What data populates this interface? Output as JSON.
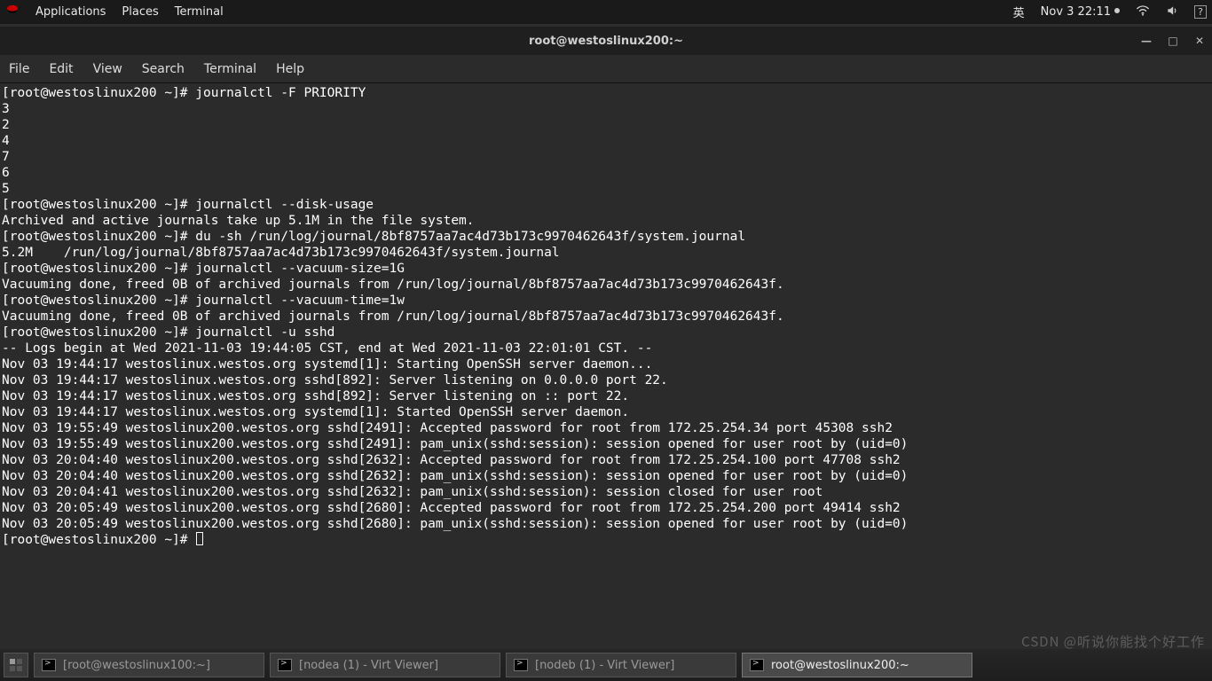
{
  "top_panel": {
    "applications": "Applications",
    "places": "Places",
    "terminal": "Terminal",
    "ime": "英",
    "datetime": "Nov 3  22:11"
  },
  "window": {
    "title": "root@westoslinux200:~"
  },
  "menubar": {
    "file": "File",
    "edit": "Edit",
    "view": "View",
    "search": "Search",
    "terminal": "Terminal",
    "help": "Help"
  },
  "terminal": {
    "lines": [
      "[root@westoslinux200 ~]# journalctl -F PRIORITY",
      "3",
      "2",
      "4",
      "7",
      "6",
      "5",
      "[root@westoslinux200 ~]# journalctl --disk-usage",
      "Archived and active journals take up 5.1M in the file system.",
      "[root@westoslinux200 ~]# du -sh /run/log/journal/8bf8757aa7ac4d73b173c9970462643f/system.journal",
      "5.2M    /run/log/journal/8bf8757aa7ac4d73b173c9970462643f/system.journal",
      "[root@westoslinux200 ~]# journalctl --vacuum-size=1G",
      "Vacuuming done, freed 0B of archived journals from /run/log/journal/8bf8757aa7ac4d73b173c9970462643f.",
      "[root@westoslinux200 ~]# journalctl --vacuum-time=1w",
      "Vacuuming done, freed 0B of archived journals from /run/log/journal/8bf8757aa7ac4d73b173c9970462643f.",
      "[root@westoslinux200 ~]# journalctl -u sshd",
      "-- Logs begin at Wed 2021-11-03 19:44:05 CST, end at Wed 2021-11-03 22:01:01 CST. --",
      "Nov 03 19:44:17 westoslinux.westos.org systemd[1]: Starting OpenSSH server daemon...",
      "Nov 03 19:44:17 westoslinux.westos.org sshd[892]: Server listening on 0.0.0.0 port 22.",
      "Nov 03 19:44:17 westoslinux.westos.org sshd[892]: Server listening on :: port 22.",
      "Nov 03 19:44:17 westoslinux.westos.org systemd[1]: Started OpenSSH server daemon.",
      "Nov 03 19:55:49 westoslinux200.westos.org sshd[2491]: Accepted password for root from 172.25.254.34 port 45308 ssh2",
      "Nov 03 19:55:49 westoslinux200.westos.org sshd[2491]: pam_unix(sshd:session): session opened for user root by (uid=0)",
      "Nov 03 20:04:40 westoslinux200.westos.org sshd[2632]: Accepted password for root from 172.25.254.100 port 47708 ssh2",
      "Nov 03 20:04:40 westoslinux200.westos.org sshd[2632]: pam_unix(sshd:session): session opened for user root by (uid=0)",
      "Nov 03 20:04:41 westoslinux200.westos.org sshd[2632]: pam_unix(sshd:session): session closed for user root",
      "Nov 03 20:05:49 westoslinux200.westos.org sshd[2680]: Accepted password for root from 172.25.254.200 port 49414 ssh2",
      "Nov 03 20:05:49 westoslinux200.westos.org sshd[2680]: pam_unix(sshd:session): session opened for user root by (uid=0)"
    ],
    "prompt": "[root@westoslinux200 ~]# "
  },
  "taskbar": {
    "item1": "[root@westoslinux100:~]",
    "item2": "[nodea (1) - Virt Viewer]",
    "item3": "[nodeb (1) - Virt Viewer]",
    "item4": "root@westoslinux200:~"
  },
  "watermark": "CSDN @听说你能找个好工作"
}
